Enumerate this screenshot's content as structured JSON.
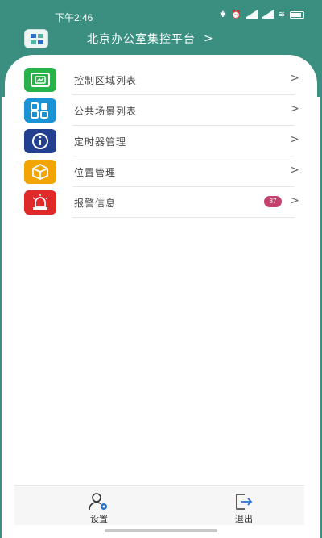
{
  "status": {
    "time": "下午2:46",
    "icons": [
      "bluetooth-icon",
      "alarm-icon",
      "signal-icon",
      "signal-icon",
      "wifi-icon",
      "battery-icon"
    ],
    "battery_text": "5G"
  },
  "header": {
    "title": "北京办公室集控平台",
    "chevron": ">"
  },
  "menu": {
    "items": [
      {
        "label": "控制区域列表",
        "icon": "control-area-icon",
        "color": "#27b24a"
      },
      {
        "label": "公共场景列表",
        "icon": "public-scene-icon",
        "color": "#1a92d6"
      },
      {
        "label": "定时器管理",
        "icon": "info-timer-icon",
        "color": "#233f8f"
      },
      {
        "label": "位置管理",
        "icon": "location-box-icon",
        "color": "#f2a400"
      },
      {
        "label": "报警信息",
        "icon": "alarm-light-icon",
        "color": "#e02a2a",
        "badge": "87"
      }
    ],
    "chevron": ">"
  },
  "bottom_bar": {
    "settings_label": "设置",
    "logout_label": "退出"
  },
  "colors": {
    "primary": "#3a8f80",
    "badge": "#c4416d"
  }
}
